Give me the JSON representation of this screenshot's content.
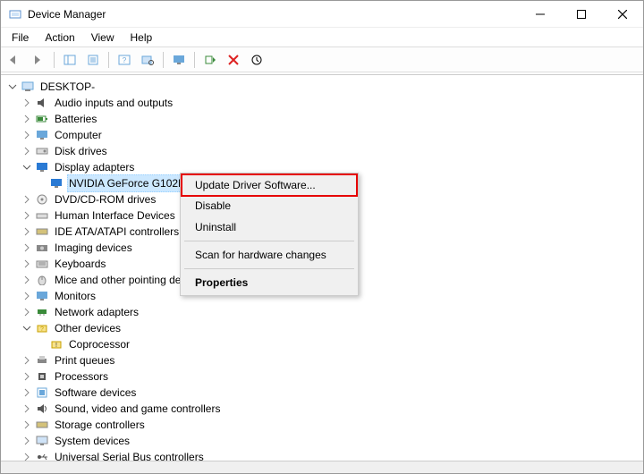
{
  "window": {
    "title": "Device Manager"
  },
  "menu": {
    "file": "File",
    "action": "Action",
    "view": "View",
    "help": "Help"
  },
  "tree": {
    "root": "DESKTOP-",
    "nodes": {
      "audio": "Audio inputs and outputs",
      "batteries": "Batteries",
      "computer": "Computer",
      "disk": "Disk drives",
      "display": "Display adapters",
      "display_child": "NVIDIA GeForce G102M",
      "dvd": "DVD/CD-ROM drives",
      "hid": "Human Interface Devices",
      "ide": "IDE ATA/ATAPI controllers",
      "imaging": "Imaging devices",
      "keyboards": "Keyboards",
      "mice": "Mice and other pointing devices",
      "monitors": "Monitors",
      "network": "Network adapters",
      "other": "Other devices",
      "other_child": "Coprocessor",
      "print": "Print queues",
      "processors": "Processors",
      "software": "Software devices",
      "sound": "Sound, video and game controllers",
      "storage": "Storage controllers",
      "system": "System devices",
      "usb": "Universal Serial Bus controllers"
    }
  },
  "context_menu": {
    "update": "Update Driver Software...",
    "disable": "Disable",
    "uninstall": "Uninstall",
    "scan": "Scan for hardware changes",
    "properties": "Properties"
  }
}
